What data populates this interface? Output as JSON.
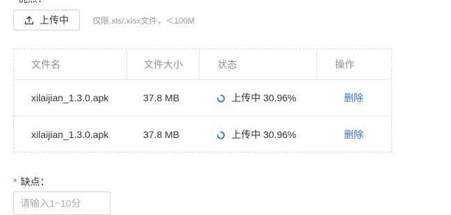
{
  "top_section": {
    "label": "优点："
  },
  "upload": {
    "button_label": "上传中",
    "hint": "仅限.xls/.xlsx文件，＜100M"
  },
  "file_table": {
    "headers": [
      "文件名",
      "文件大小",
      "状态",
      "操作"
    ],
    "rows": [
      {
        "name": "xilaijian_1.3.0.apk",
        "size": "37.8 MB",
        "status": "上传中 30.96%",
        "action": "删除"
      },
      {
        "name": "xilaijian_1.3.0.apk",
        "size": "37.8 MB",
        "status": "上传中 30.96%",
        "action": "删除"
      }
    ]
  },
  "cons_section": {
    "required_mark": "*",
    "label": "缺点：",
    "input_placeholder": "请输入1~10分"
  },
  "colors": {
    "accent": "#2d6fd7",
    "required": "#e84a4a",
    "border": "#d5d8de"
  },
  "icons": {
    "upload": "upload-icon",
    "loading": "loading-spinner-icon"
  }
}
